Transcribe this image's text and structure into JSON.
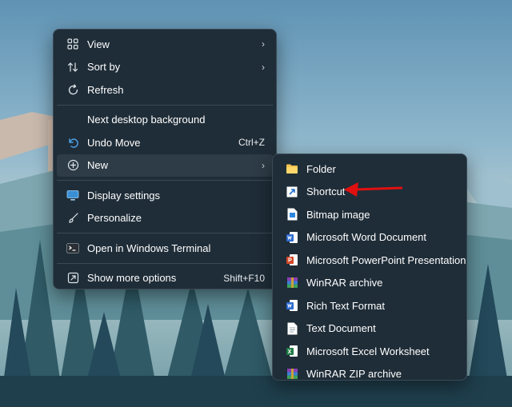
{
  "main_menu": {
    "items": [
      {
        "label": "View",
        "icon": "grid-icon",
        "chevron": "›"
      },
      {
        "label": "Sort by",
        "icon": "sort-arrows-icon",
        "chevron": "›"
      },
      {
        "label": "Refresh",
        "icon": "refresh-icon"
      },
      {
        "label": "Next desktop background"
      },
      {
        "label": "Undo Move",
        "icon": "undo-icon",
        "shortcut": "Ctrl+Z"
      },
      {
        "label": "New",
        "icon": "plus-circle-icon",
        "chevron": "›"
      },
      {
        "label": "Display settings",
        "icon": "display-icon"
      },
      {
        "label": "Personalize",
        "icon": "brush-icon"
      },
      {
        "label": "Open in Windows Terminal",
        "icon": "terminal-icon"
      },
      {
        "label": "Show more options",
        "icon": "more-options-icon",
        "shortcut": "Shift+F10"
      }
    ]
  },
  "sub_menu": {
    "items": [
      {
        "label": "Folder",
        "icon": "folder-icon"
      },
      {
        "label": "Shortcut",
        "icon": "shortcut-icon"
      },
      {
        "label": "Bitmap image",
        "icon": "bitmap-icon"
      },
      {
        "label": "Microsoft Word Document",
        "icon": "word-icon"
      },
      {
        "label": "Microsoft PowerPoint Presentation",
        "icon": "powerpoint-icon"
      },
      {
        "label": "WinRAR archive",
        "icon": "winrar-icon"
      },
      {
        "label": "Rich Text Format",
        "icon": "rtf-icon"
      },
      {
        "label": "Text Document",
        "icon": "text-document-icon"
      },
      {
        "label": "Microsoft Excel Worksheet",
        "icon": "excel-icon"
      },
      {
        "label": "WinRAR ZIP archive",
        "icon": "winrar-zip-icon"
      }
    ]
  },
  "colors": {
    "menu_bg": "#1f2d38",
    "highlight": "#2e3c47",
    "annotation_arrow": "#e01010",
    "folder": "#f4c14f",
    "word": "#2b6bd1",
    "powerpoint": "#d24726",
    "excel": "#1e7a45",
    "accent": "#4ea3e8"
  }
}
